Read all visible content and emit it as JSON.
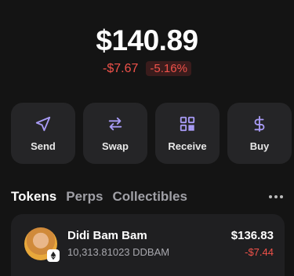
{
  "balance": {
    "amount": "$140.89",
    "change_abs": "-$7.67",
    "change_pct": "-5.16%"
  },
  "actions": [
    {
      "label": "Send",
      "icon": "send-icon"
    },
    {
      "label": "Swap",
      "icon": "swap-icon"
    },
    {
      "label": "Receive",
      "icon": "qr-code-icon"
    },
    {
      "label": "Buy",
      "icon": "dollar-icon"
    }
  ],
  "tabs": [
    {
      "label": "Tokens",
      "active": true
    },
    {
      "label": "Perps",
      "active": false
    },
    {
      "label": "Collectibles",
      "active": false
    }
  ],
  "tokens": [
    {
      "name": "Didi Bam Bam",
      "quantity": "10,313.81023 DDBAM",
      "value": "$136.83",
      "change": "-$7.44",
      "chain_icon": "ethereum-icon"
    }
  ],
  "colors": {
    "accent": "#a89bf5",
    "negative": "#f0524a",
    "background": "#141414",
    "card": "#252527"
  }
}
